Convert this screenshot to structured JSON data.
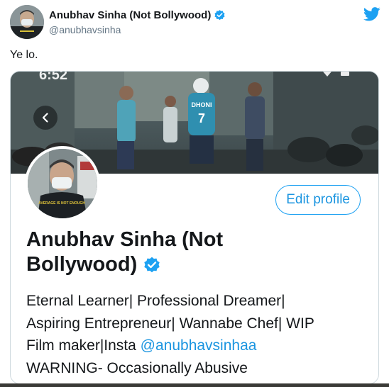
{
  "tweet": {
    "author_name": "Anubhav Sinha (Not Bollywood)",
    "author_handle": "@anubhavsinha",
    "text": "Ye lo."
  },
  "screenshot": {
    "status_time": "6:52",
    "edit_profile_label": "Edit profile",
    "profile_name_line1": "Anubhav Sinha (Not",
    "profile_name_line2": "Bollywood)",
    "bio_line1": "Eternal Learner| Professional Dreamer|",
    "bio_line2": "Aspiring Entrepreneur| Wannabe Chef| WIP",
    "bio_line3_text": "Film maker|Insta ",
    "bio_line3_link": "@anubhavsinhaa",
    "bio_line4": "WARNING- Occasionally Abusive",
    "banner_jersey_text": "DHONI",
    "banner_jersey_number": "7",
    "avatar_shirt_text": "AVERAGE IS NOT ENOUGH"
  },
  "colors": {
    "twitter_blue": "#1da1f2",
    "link_blue": "#1b95e0",
    "text_dark": "#14171a",
    "text_muted": "#657786",
    "border": "#cfd9de"
  },
  "icons": [
    "verified-badge-icon",
    "twitter-bird-icon",
    "back-arrow-icon"
  ]
}
